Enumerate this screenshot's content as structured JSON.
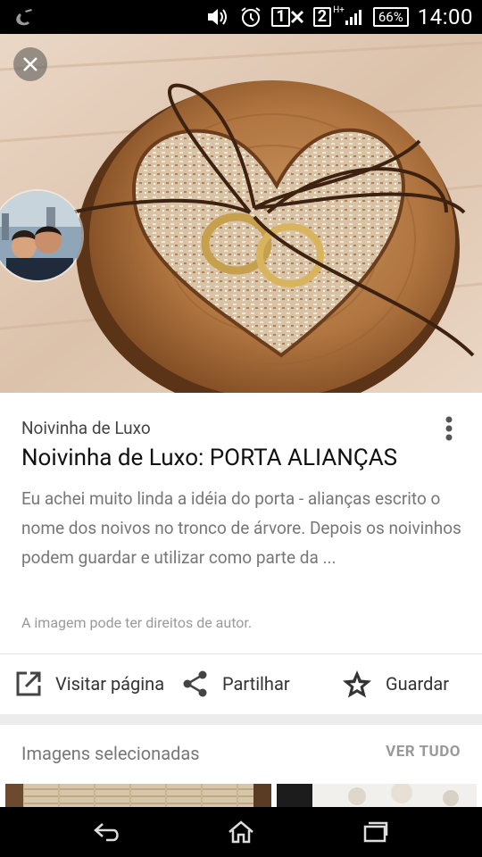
{
  "status_bar": {
    "sim1": "1",
    "sim2": "2",
    "network_type": "H+",
    "battery": "66%",
    "time": "14:00"
  },
  "hero": {
    "image_icon": "wooden-heart-ring-holder-image",
    "avatar_icon": "couple-avatar"
  },
  "result": {
    "source": "Noivinha de Luxo",
    "title": "Noivinha de Luxo: PORTA ALIANÇAS",
    "description": "Eu achei muito linda a idéia do porta - alianças escrito o nome dos noivos no tronco de árvore. Depois os noivinhos podem guardar e utilizar como parte da ...",
    "rights_note": "A imagem pode ter direitos de autor."
  },
  "actions": {
    "visit_label": "Visitar página",
    "share_label": "Partilhar",
    "save_label": "Guardar"
  },
  "selected": {
    "title": "Imagens selecionadas",
    "see_all": "VER TUDO"
  },
  "colors": {
    "accent_text": "#333333",
    "muted_text": "#777777",
    "wood": "#b8865a"
  }
}
